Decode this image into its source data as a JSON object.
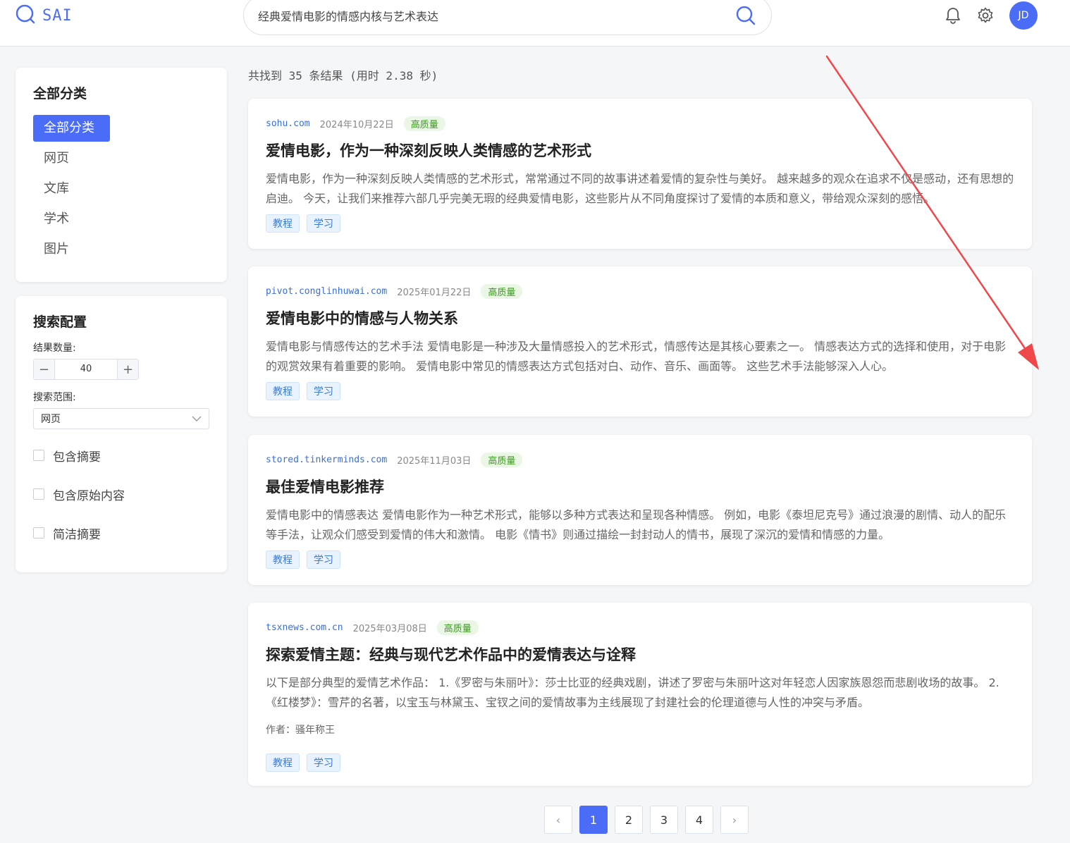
{
  "header": {
    "logo_text": "SAI",
    "search_value": "经典爱情电影的情感内核与艺术表达",
    "avatar_initials": "JD"
  },
  "sidebar": {
    "categories_title": "全部分类",
    "categories": [
      {
        "label": "全部分类",
        "active": true
      },
      {
        "label": "网页",
        "active": false
      },
      {
        "label": "文库",
        "active": false
      },
      {
        "label": "学术",
        "active": false
      },
      {
        "label": "图片",
        "active": false
      }
    ],
    "config": {
      "title": "搜索配置",
      "count_label": "结果数量:",
      "count_value": "40",
      "scope_label": "搜索范围:",
      "scope_value": "网页",
      "checkboxes": [
        {
          "label": "包含摘要",
          "checked": false
        },
        {
          "label": "包含原始内容",
          "checked": false
        },
        {
          "label": "简洁摘要",
          "checked": false
        }
      ]
    }
  },
  "results": {
    "summary": "共找到 35 条结果 (用时 2.38 秒)",
    "items": [
      {
        "domain": "sohu.com",
        "date": "2024年10月22日",
        "badge": "高质量",
        "title": "爱情电影，作为一种深刻反映人类情感的艺术形式",
        "snippet": "爱情电影，作为一种深刻反映人类情感的艺术形式，常常通过不同的故事讲述着爱情的复杂性与美好。 越来越多的观众在追求不仅是感动，还有思想的启迪。 今天，让我们来推荐六部几乎完美无瑕的经典爱情电影，这些影片从不同角度探讨了爱情的本质和意义，带给观众深刻的感悟。",
        "tags": [
          "教程",
          "学习"
        ]
      },
      {
        "domain": "pivot.conglinhuwai.com",
        "date": "2025年01月22日",
        "badge": "高质量",
        "title": "爱情电影中的情感与人物关系",
        "snippet": "爱情电影与情感传达的艺术手法 爱情电影是一种涉及大量情感投入的艺术形式，情感传达是其核心要素之一。 情感表达方式的选择和使用，对于电影的观赏效果有着重要的影响。 爱情电影中常见的情感表达方式包括对白、动作、音乐、画面等。 这些艺术手法能够深入人心。",
        "tags": [
          "教程",
          "学习"
        ]
      },
      {
        "domain": "stored.tinkerminds.com",
        "date": "2025年11月03日",
        "badge": "高质量",
        "title": "最佳爱情电影推荐",
        "snippet": "爱情电影中的情感表达 爱情电影作为一种艺术形式，能够以多种方式表达和呈现各种情感。 例如，电影《泰坦尼克号》通过浪漫的剧情、动人的配乐等手法，让观众们感受到爱情的伟大和激情。 电影《情书》则通过描绘一封封动人的情书，展现了深沉的爱情和情感的力量。",
        "tags": [
          "教程",
          "学习"
        ]
      },
      {
        "domain": "tsxnews.com.cn",
        "date": "2025年03月08日",
        "badge": "高质量",
        "title": "探索爱情主题：经典与现代艺术作品中的爱情表达与诠释",
        "snippet": "以下是部分典型的爱情艺术作品： 1.《罗密与朱丽叶》：莎士比亚的经典戏剧，讲述了罗密与朱丽叶这对年轻恋人因家族恩怨而悲剧收场的故事。 2.《红楼梦》：雪芹的名著，以宝玉与林黛玉、宝钗之间的爱情故事为主线展现了封建社会的伦理道德与人性的冲突与矛盾。",
        "author": "作者：骚年称王",
        "tags": [
          "教程",
          "学习"
        ]
      }
    ]
  },
  "pagination": {
    "prev": "‹",
    "pages": [
      "1",
      "2",
      "3",
      "4"
    ],
    "current": "1",
    "next": "›"
  },
  "colors": {
    "accent": "#4a6cf7",
    "quality_bg": "#eaf7e4",
    "quality_text": "#3a9a1e",
    "annotation_arrow": "#f0474a"
  }
}
